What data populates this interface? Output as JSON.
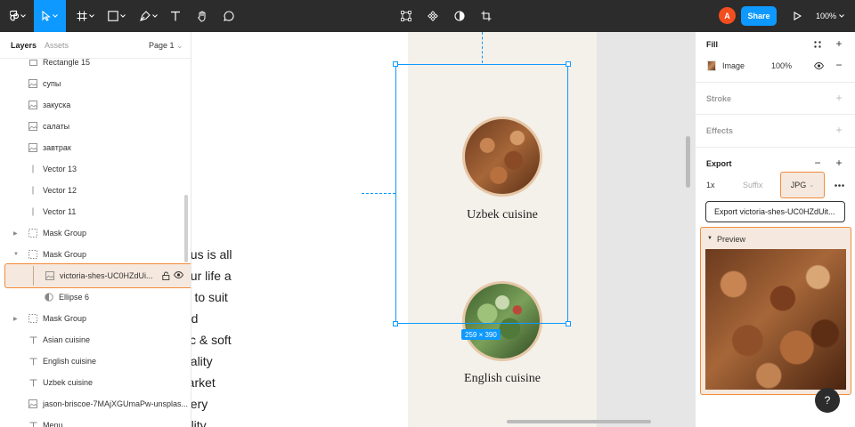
{
  "toolbar": {
    "share_label": "Share",
    "zoom_label": "100%",
    "avatar_initial": "A"
  },
  "left_panel": {
    "tab_layers": "Layers",
    "tab_assets": "Assets",
    "page_label": "Page 1",
    "layers": [
      {
        "name": "Rectangle 15",
        "icon": "rect-icon"
      },
      {
        "name": "супы",
        "icon": "image-icon"
      },
      {
        "name": "закуска",
        "icon": "image-icon"
      },
      {
        "name": "салаты",
        "icon": "image-icon"
      },
      {
        "name": "завтрак",
        "icon": "image-icon"
      },
      {
        "name": "Vector 13",
        "icon": "vector-icon"
      },
      {
        "name": "Vector 12",
        "icon": "vector-icon"
      },
      {
        "name": "Vector 11",
        "icon": "vector-icon"
      },
      {
        "name": "Mask Group",
        "icon": "mask-icon",
        "expanded": false
      },
      {
        "name": "Mask Group",
        "icon": "mask-icon",
        "expanded": true
      },
      {
        "name": "victoria-shes-UC0HZdUi...",
        "icon": "image-icon",
        "selected": true
      },
      {
        "name": "Ellipse 6",
        "icon": "ellipse-mask-icon"
      },
      {
        "name": "Mask Group",
        "icon": "mask-icon",
        "expanded": false
      },
      {
        "name": "Asian cuisine",
        "icon": "text-icon"
      },
      {
        "name": "English cuisine",
        "icon": "text-icon"
      },
      {
        "name": "Uzbek cuisine",
        "icon": "text-icon"
      },
      {
        "name": "jason-briscoe-7MAjXGUmaPw-unsplas...",
        "icon": "image-icon"
      },
      {
        "name": "Menu",
        "icon": "text-icon"
      }
    ]
  },
  "canvas": {
    "side_text": [
      "ocus is all",
      "your life a",
      "nu to suit",
      "and",
      "olic & soft",
      "pitality",
      "Market",
      "every",
      "uality"
    ],
    "cuisine_titles": [
      "Uzbek cuisine",
      "English cuisine"
    ],
    "selection_size": "259 × 390"
  },
  "right_panel": {
    "fill_title": "Fill",
    "fill_type": "Image",
    "fill_opacity": "100%",
    "stroke_title": "Stroke",
    "effects_title": "Effects",
    "export_title": "Export",
    "export_scale": "1x",
    "export_suffix_placeholder": "Suffix",
    "export_format": "JPG",
    "export_button": "Export victoria-shes-UC0HZdUit...",
    "preview_title": "Preview"
  },
  "help_label": "?",
  "colors": {
    "toolbar_bg": "#2c2c2c",
    "accent_blue": "#0d99ff",
    "highlight_orange": "#f28c3b",
    "frame_bg": "#f4f0ea"
  }
}
